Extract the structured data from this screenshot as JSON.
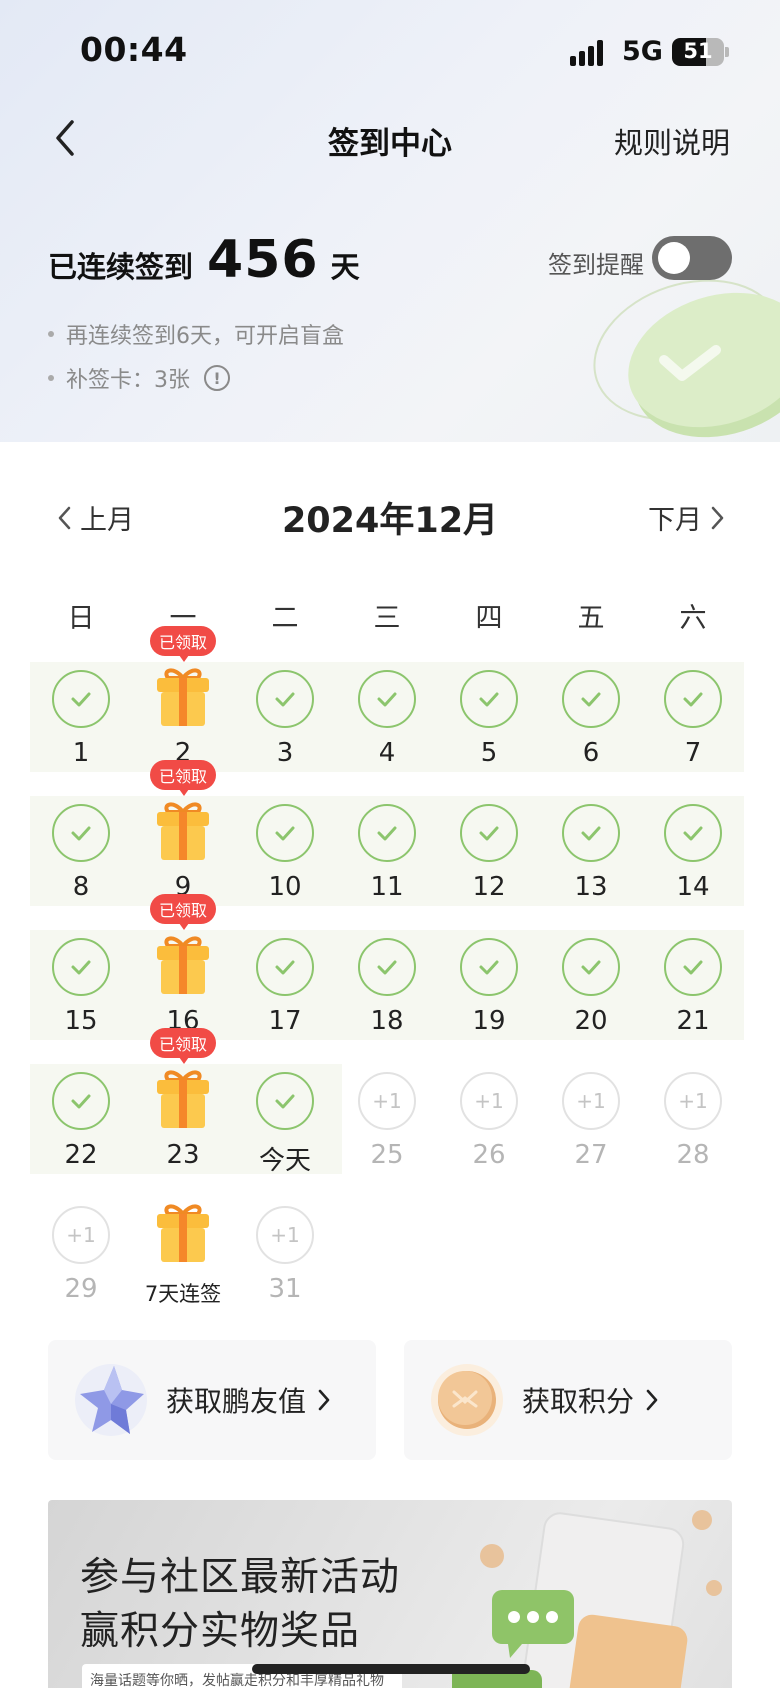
{
  "status_bar": {
    "time": "00:44",
    "network": "5G",
    "battery": "51"
  },
  "nav": {
    "title": "签到中心",
    "rules": "规则说明"
  },
  "streak": {
    "prefix": "已连续签到",
    "days": "456",
    "unit": "天"
  },
  "reminder": {
    "label": "签到提醒",
    "enabled": false
  },
  "tips": {
    "tip1": "再连续签到6天，可开启盲盒",
    "tip2": "补签卡：3张"
  },
  "calendar": {
    "prev_label": "上月",
    "next_label": "下月",
    "month_title": "2024年12月",
    "weekdays": [
      "日",
      "一",
      "二",
      "三",
      "四",
      "五",
      "六"
    ],
    "badge_text": "已领取",
    "plus_text": "+1",
    "days": [
      {
        "label": "1",
        "state": "checked"
      },
      {
        "label": "2",
        "state": "gift-claimed"
      },
      {
        "label": "3",
        "state": "checked"
      },
      {
        "label": "4",
        "state": "checked"
      },
      {
        "label": "5",
        "state": "checked"
      },
      {
        "label": "6",
        "state": "checked"
      },
      {
        "label": "7",
        "state": "checked"
      },
      {
        "label": "8",
        "state": "checked"
      },
      {
        "label": "9",
        "state": "gift-claimed"
      },
      {
        "label": "10",
        "state": "checked"
      },
      {
        "label": "11",
        "state": "checked"
      },
      {
        "label": "12",
        "state": "checked"
      },
      {
        "label": "13",
        "state": "checked"
      },
      {
        "label": "14",
        "state": "checked"
      },
      {
        "label": "15",
        "state": "checked"
      },
      {
        "label": "16",
        "state": "gift-claimed"
      },
      {
        "label": "17",
        "state": "checked"
      },
      {
        "label": "18",
        "state": "checked"
      },
      {
        "label": "19",
        "state": "checked"
      },
      {
        "label": "20",
        "state": "checked"
      },
      {
        "label": "21",
        "state": "checked"
      },
      {
        "label": "22",
        "state": "checked"
      },
      {
        "label": "23",
        "state": "gift-claimed"
      },
      {
        "label": "今天",
        "state": "checked"
      },
      {
        "label": "25",
        "state": "future"
      },
      {
        "label": "26",
        "state": "future"
      },
      {
        "label": "27",
        "state": "future"
      },
      {
        "label": "28",
        "state": "future"
      },
      {
        "label": "29",
        "state": "future"
      },
      {
        "label": "7天连签",
        "state": "gift"
      },
      {
        "label": "31",
        "state": "future"
      }
    ]
  },
  "rewards": {
    "friend_value": "获取鹏友值",
    "points": "获取积分"
  },
  "banner": {
    "line1": "参与社区最新活动",
    "line2": "赢积分实物奖品",
    "sub": "海量话题等你晒，发帖赢走积分和丰厚精品礼物"
  },
  "colors": {
    "check_green": "#8cc56d",
    "badge_red": "#f14b46",
    "gift_orange": "#f7a52a"
  }
}
